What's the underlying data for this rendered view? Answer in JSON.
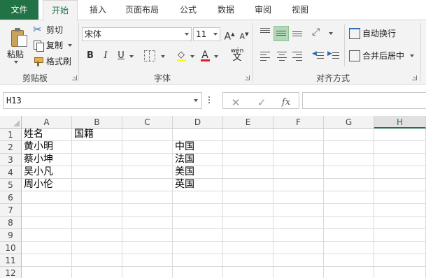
{
  "tabs": {
    "file": "文件",
    "items": [
      "开始",
      "插入",
      "页面布局",
      "公式",
      "数据",
      "审阅",
      "视图"
    ],
    "active_index": 0
  },
  "clipboard": {
    "paste": "粘贴",
    "cut": "剪切",
    "copy": "复制",
    "format_painter": "格式刷",
    "group_label": "剪贴板"
  },
  "font": {
    "family": "宋体",
    "size": "11",
    "grow_label": "A",
    "shrink_label": "A",
    "bold": "B",
    "italic": "I",
    "underline": "U",
    "fill_label": "",
    "color_label": "A",
    "phonetic_label": "wén",
    "group_label": "字体",
    "fill_color": "#ffff00",
    "font_color": "#e51c23"
  },
  "alignment": {
    "wrap_text": "自动换行",
    "merge_center": "合并后居中",
    "group_label": "对齐方式",
    "middle_align_active": true
  },
  "formula_bar": {
    "name_box": "H13",
    "cancel_icon": "✕",
    "enter_icon": "✓",
    "fx_icon": "fx",
    "formula": ""
  },
  "sheet": {
    "columns": [
      "A",
      "B",
      "C",
      "D",
      "E",
      "F",
      "G",
      "H"
    ],
    "selected_column": "H",
    "rows": [
      "1",
      "2",
      "3",
      "4",
      "5",
      "6",
      "7",
      "8",
      "9",
      "10",
      "11",
      "12"
    ],
    "cells": {
      "A1": "姓名",
      "B1": "国籍",
      "A2": "黄小明",
      "D2": "中国",
      "A3": "蔡小坤",
      "D3": "法国",
      "A4": "吴小凡",
      "D4": "美国",
      "A5": "周小伦",
      "D5": "英国"
    },
    "accent_color": "#217346"
  }
}
